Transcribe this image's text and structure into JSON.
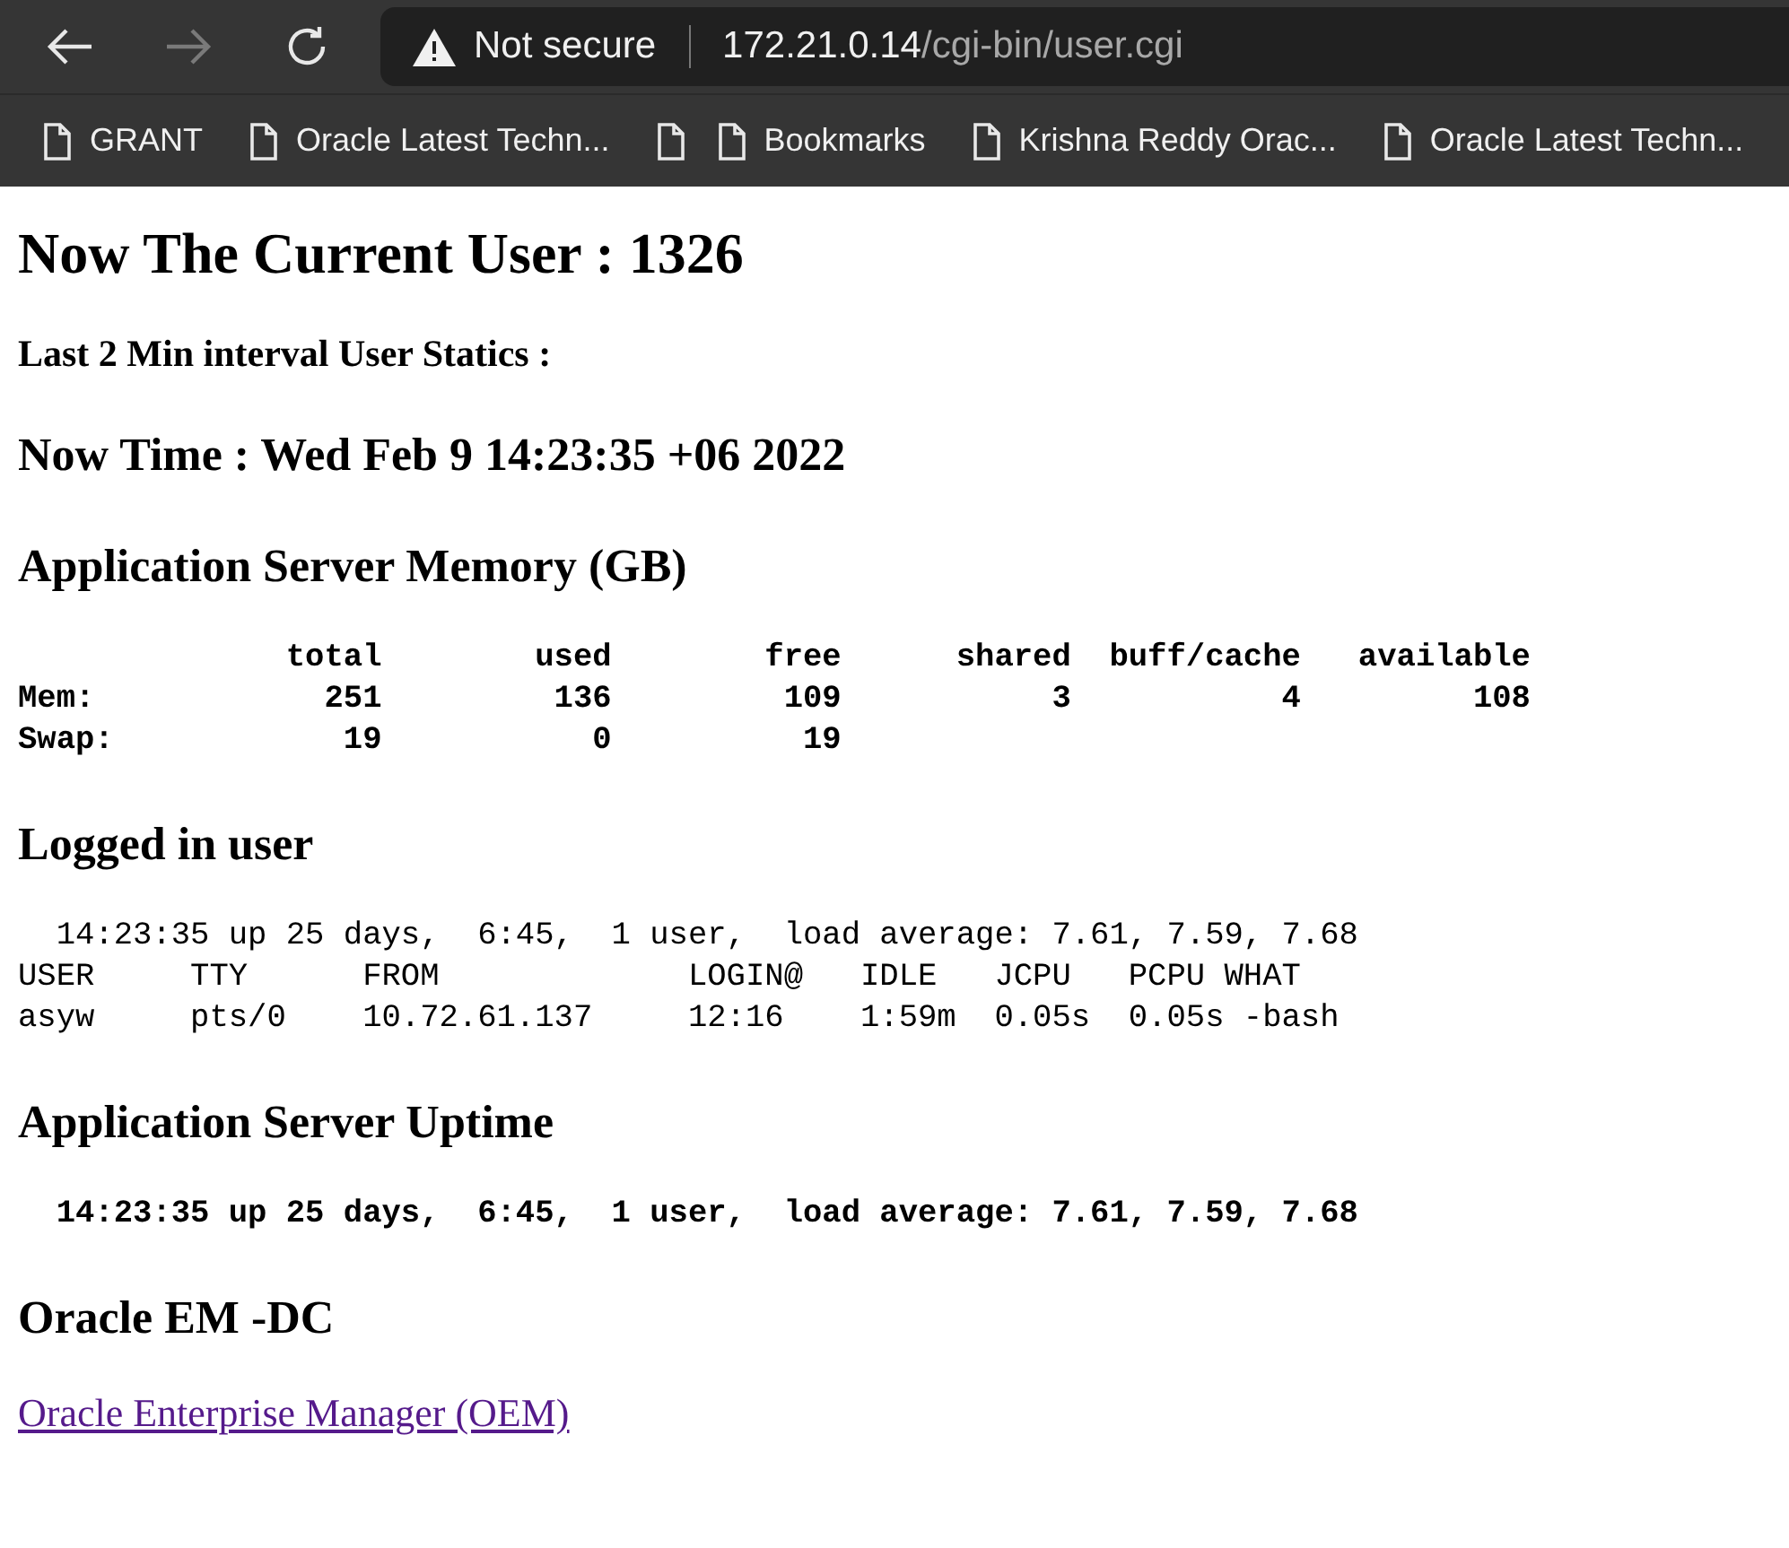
{
  "browser": {
    "security_label": "Not secure",
    "url_host": "172.21.0.14",
    "url_path": "/cgi-bin/user.cgi",
    "forward_disabled": true,
    "bookmarks": [
      {
        "kind": "page",
        "label": "GRANT"
      },
      {
        "kind": "page",
        "label": "Oracle Latest Techn..."
      },
      {
        "kind": "icon"
      },
      {
        "kind": "page",
        "label": "Bookmarks"
      },
      {
        "kind": "page",
        "label": "Krishna Reddy Orac..."
      },
      {
        "kind": "page",
        "label": "Oracle Latest Techn..."
      }
    ]
  },
  "page": {
    "title": "Now The Current User : 1326",
    "subtitle": "Last 2 Min interval User Statics :",
    "now_time": "Now Time : Wed Feb 9 14:23:35 +06 2022",
    "sections": [
      {
        "heading": "Application Server Memory (GB)",
        "bold": true,
        "lines": [
          "              total        used        free      shared  buff/cache   available",
          "Mem:            251         136         109           3           4         108",
          "Swap:            19           0          19"
        ]
      },
      {
        "heading": "Logged in user",
        "bold": false,
        "lines": [
          "  14:23:35 up 25 days,  6:45,  1 user,  load average: 7.61, 7.59, 7.68",
          "USER     TTY      FROM             LOGIN@   IDLE   JCPU   PCPU WHAT",
          "asyw     pts/0    10.72.61.137     12:16    1:59m  0.05s  0.05s -bash"
        ]
      },
      {
        "heading": "Application Server Uptime",
        "bold": true,
        "lines": [
          "  14:23:35 up 25 days,  6:45,  1 user,  load average: 7.61, 7.59, 7.68"
        ]
      },
      {
        "heading": "Oracle EM -DC",
        "link": "Oracle Enterprise Manager (OEM)"
      }
    ]
  }
}
